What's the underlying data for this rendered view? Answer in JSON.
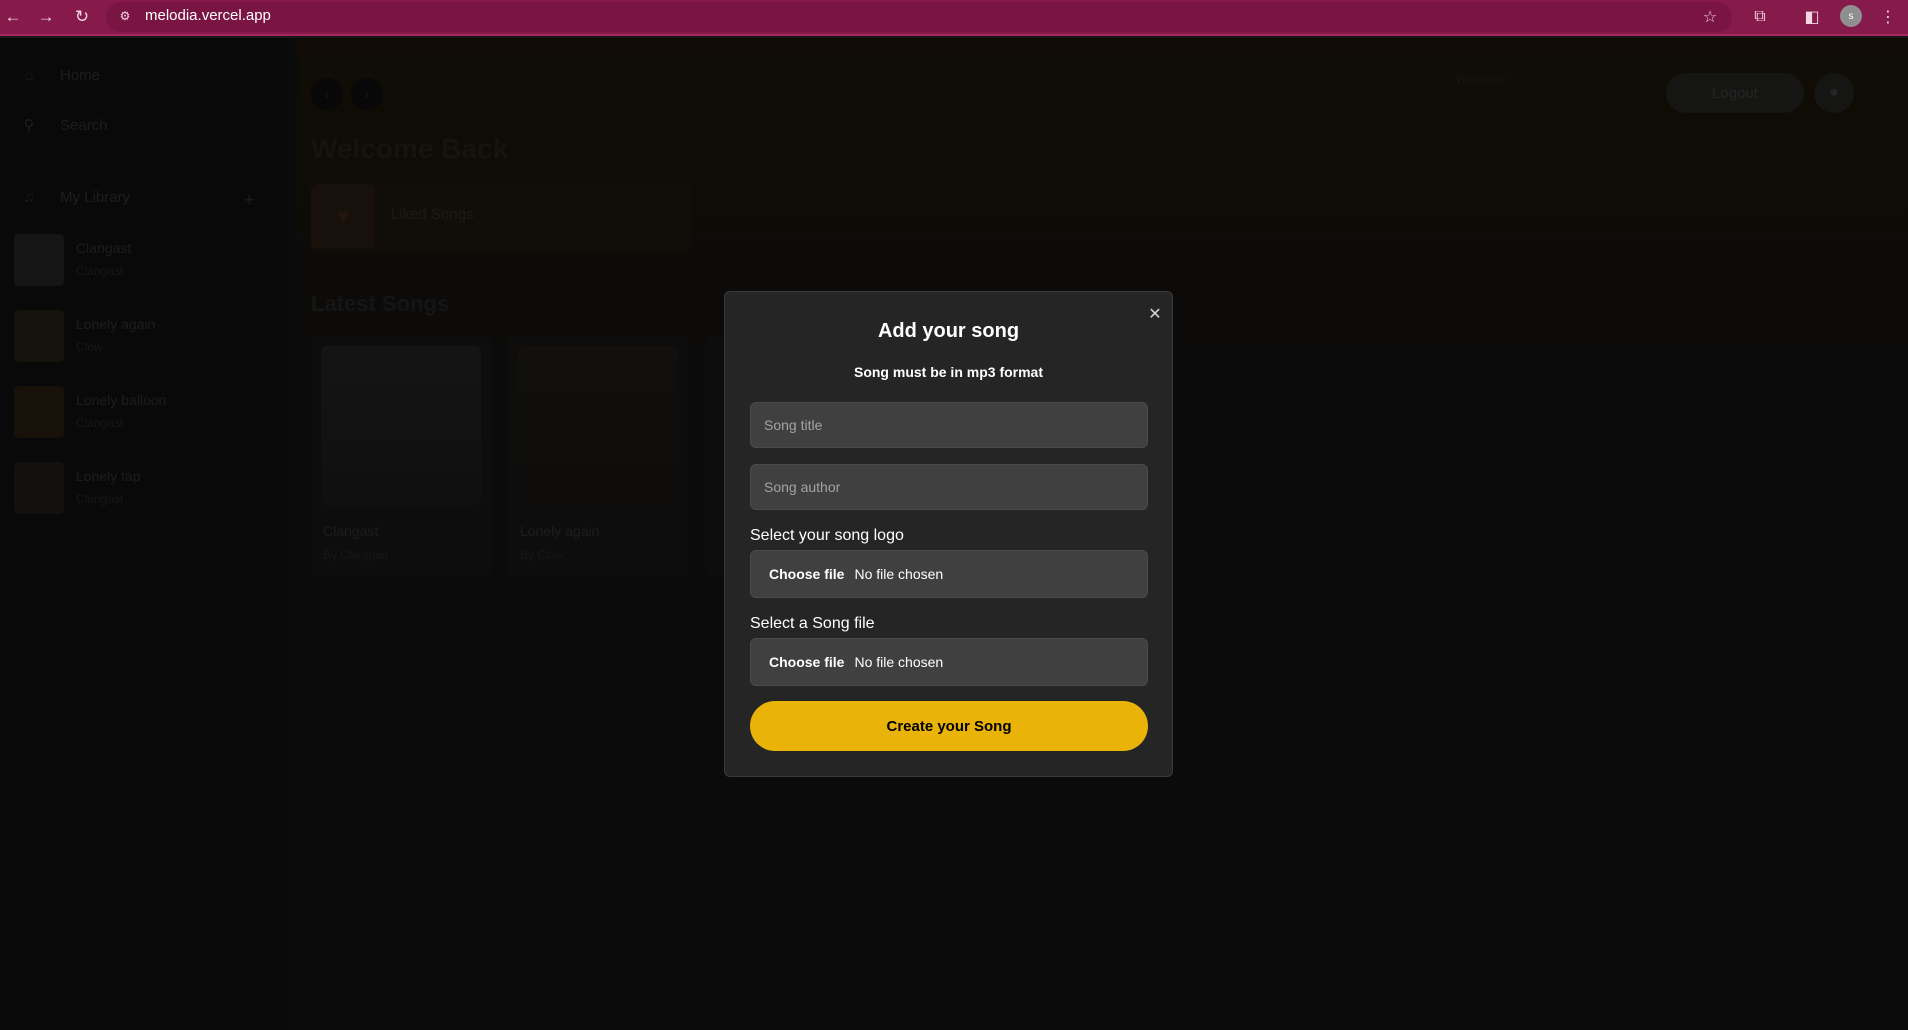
{
  "browser": {
    "url": "melodia.vercel.app",
    "profile_initial": "s"
  },
  "sidebar": {
    "nav": [
      {
        "label": "Home",
        "icon": "home-icon"
      },
      {
        "label": "Search",
        "icon": "search-icon"
      }
    ],
    "library_label": "My Library",
    "library_items": [
      {
        "title": "Clangast",
        "author": "Clangast"
      },
      {
        "title": "Lonely again",
        "author": "Clow"
      },
      {
        "title": "Lonely balloon",
        "author": "Clangast"
      },
      {
        "title": "Lonely tap",
        "author": "Clangast"
      }
    ]
  },
  "main": {
    "header": {
      "welcome_small": "Welcome",
      "logout_label": "Logout"
    },
    "welcome_title": "Welcome Back",
    "liked_songs_label": "Liked Songs",
    "latest_title": "Latest Songs",
    "songs": [
      {
        "name": "Clangast",
        "by": "By Clangast"
      },
      {
        "name": "Lonely again",
        "by": "By Clow"
      }
    ]
  },
  "modal": {
    "title": "Add your song",
    "subtitle": "Song must be in mp3 format",
    "song_title_placeholder": "Song title",
    "song_author_placeholder": "Song author",
    "logo_label": "Select your song logo",
    "file_label": "Select a Song file",
    "choose_file": "Choose file",
    "no_file": "No file chosen",
    "submit_label": "Create your Song",
    "accent": "#eab308"
  }
}
